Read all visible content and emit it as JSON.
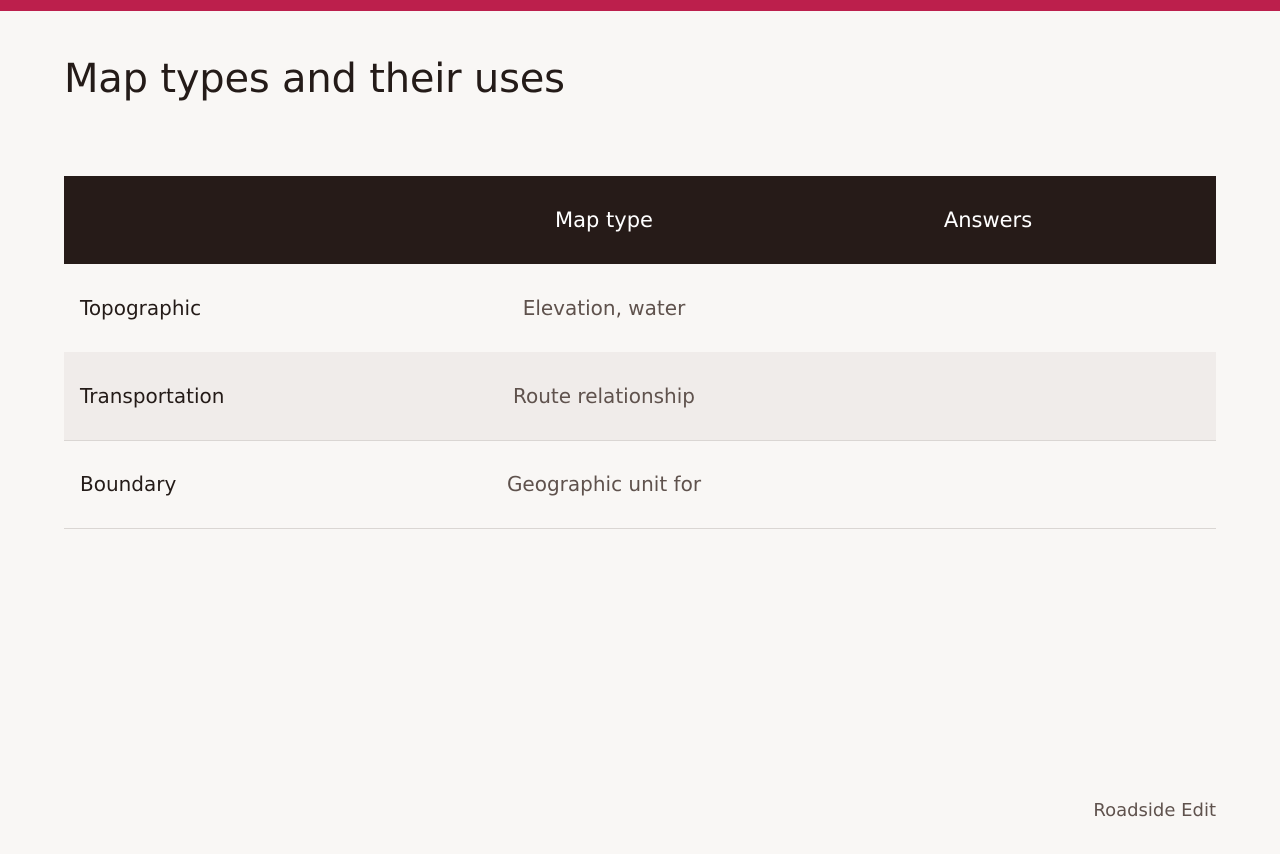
{
  "accent_color": "#bc1f4c",
  "header_color": "#261b18",
  "page": {
    "title": "Map types and their uses"
  },
  "table": {
    "headers": [
      "",
      "Map type",
      "Answers"
    ],
    "rows": [
      {
        "name": "Topographic",
        "use": "Elevation, water",
        "answer": ""
      },
      {
        "name": "Transportation",
        "use": "Route relationship",
        "answer": ""
      },
      {
        "name": "Boundary",
        "use": "Geographic unit for",
        "answer": ""
      }
    ]
  },
  "footer": {
    "brand": "Roadside Edit"
  }
}
